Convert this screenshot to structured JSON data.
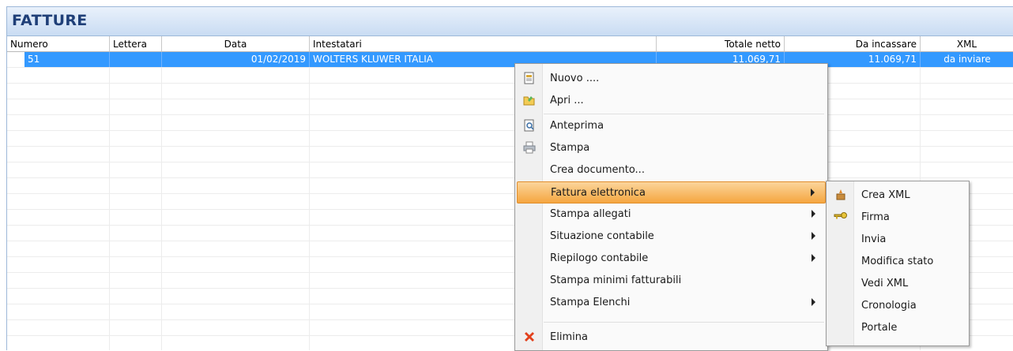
{
  "window": {
    "title": "FATTURE"
  },
  "table": {
    "columns": [
      "Numero",
      "Lettera",
      "Data",
      "Intestatari",
      "Totale netto",
      "Da incassare",
      "XML"
    ],
    "rows": [
      {
        "numero": "51",
        "lettera": "",
        "data": "01/02/2019",
        "intestatari": "WOLTERS KLUWER ITALIA",
        "totale_netto": "11.069,71",
        "da_incassare": "11.069,71",
        "xml": "da inviare"
      }
    ]
  },
  "context_menu": {
    "items": [
      {
        "label": "Nuovo ....",
        "icon": "new-document-icon"
      },
      {
        "label": "Apri ...",
        "icon": "open-folder-icon"
      },
      {
        "label": "Anteprima",
        "icon": "preview-icon"
      },
      {
        "label": "Stampa",
        "icon": "printer-icon"
      },
      {
        "label": "Crea documento...",
        "icon": ""
      },
      {
        "label": "Fattura elettronica",
        "icon": "",
        "submenu": true,
        "highlighted": true
      },
      {
        "label": "Stampa allegati",
        "icon": "",
        "submenu": true
      },
      {
        "label": "Situazione contabile",
        "icon": "",
        "submenu": true
      },
      {
        "label": "Riepilogo contabile",
        "icon": "",
        "submenu": true
      },
      {
        "label": "Stampa minimi fatturabili",
        "icon": ""
      },
      {
        "label": "Stampa Elenchi",
        "icon": "",
        "submenu": true
      },
      {
        "label": "Elimina",
        "icon": "delete-icon"
      }
    ]
  },
  "submenu": {
    "items": [
      {
        "label": "Crea XML",
        "icon": "create-xml-icon"
      },
      {
        "label": "Firma",
        "icon": "key-icon"
      },
      {
        "label": "Invia",
        "icon": ""
      },
      {
        "label": "Modifica stato",
        "icon": ""
      },
      {
        "label": "Vedi XML",
        "icon": ""
      },
      {
        "label": "Cronologia",
        "icon": ""
      },
      {
        "label": "Portale",
        "icon": ""
      }
    ]
  },
  "colors": {
    "selection": "#3399ff",
    "title_text": "#1f3f78",
    "menu_highlight": "#f5a640"
  }
}
